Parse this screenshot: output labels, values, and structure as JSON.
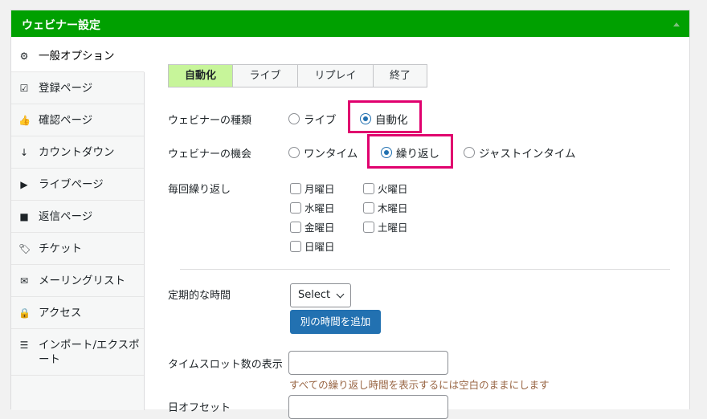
{
  "panel": {
    "title": "ウェビナー設定"
  },
  "sidebar": {
    "items": [
      {
        "label": "一般オプション",
        "icon": "gear-icon",
        "glyph": "⚙"
      },
      {
        "label": "登録ページ",
        "icon": "checkbox-icon",
        "glyph": "☑"
      },
      {
        "label": "確認ページ",
        "icon": "thumbs-up-icon",
        "glyph": "👍"
      },
      {
        "label": "カウントダウン",
        "icon": "sort-icon",
        "glyph": "↓"
      },
      {
        "label": "ライブページ",
        "icon": "play-icon",
        "glyph": "▶"
      },
      {
        "label": "返信ページ",
        "icon": "video-icon",
        "glyph": "■"
      },
      {
        "label": "チケット",
        "icon": "tags-icon",
        "glyph": "🏷"
      },
      {
        "label": "メーリングリスト",
        "icon": "envelope-icon",
        "glyph": "✉"
      },
      {
        "label": "アクセス",
        "icon": "lock-icon",
        "glyph": "🔒"
      },
      {
        "label": "インポート/エクスポート",
        "icon": "list-icon",
        "glyph": "☰"
      }
    ]
  },
  "tabs": [
    "自動化",
    "ライブ",
    "リプレイ",
    "終了"
  ],
  "webinar_type": {
    "label": "ウェビナーの種類",
    "options": [
      "ライブ",
      "自動化"
    ],
    "selected": "自動化"
  },
  "webinar_occurrence": {
    "label": "ウェビナーの機会",
    "options": [
      "ワンタイム",
      "繰り返し",
      "ジャストインタイム"
    ],
    "selected": "繰り返し"
  },
  "repeat": {
    "label": "毎回繰り返し",
    "days": [
      "月曜日",
      "火曜日",
      "水曜日",
      "木曜日",
      "金曜日",
      "土曜日",
      "日曜日"
    ]
  },
  "schedule": {
    "label": "定期的な時間",
    "select_value": "Select",
    "add_button": "別の時間を追加"
  },
  "timeslots": {
    "label": "タイムスロット数の表示",
    "hint": "すべての繰り返し時間を表示するには空白のままにします"
  },
  "day_offset": {
    "label": "日オフセット"
  },
  "colors": {
    "header": "#00a000",
    "active_tab": "#c7f59a",
    "highlight": "#e0006e",
    "primary_button": "#2271b1"
  }
}
